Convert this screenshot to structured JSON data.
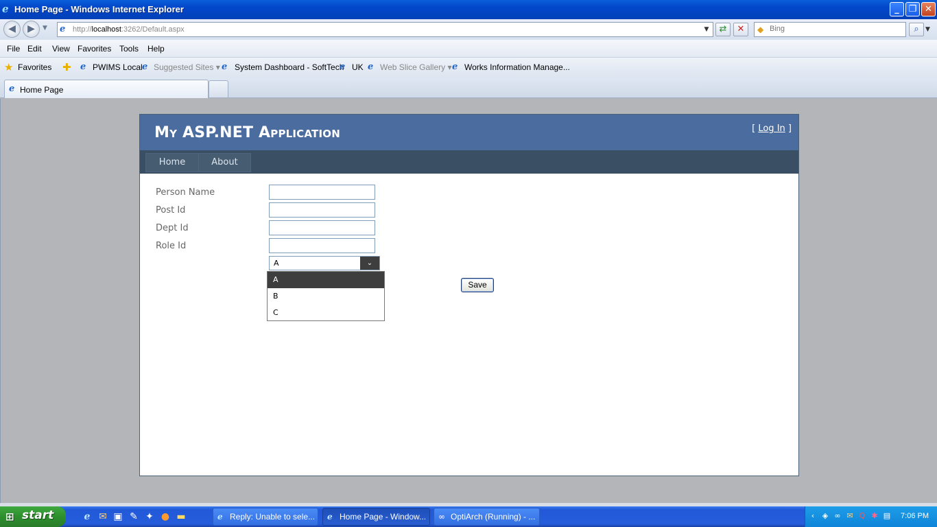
{
  "window": {
    "title": "Home Page - Windows Internet Explorer"
  },
  "addressbar": {
    "url_prefix": "http://",
    "url_host": "localhost",
    "url_suffix": ":3262/Default.aspx",
    "search_placeholder": "Bing"
  },
  "menu": [
    "File",
    "Edit",
    "View",
    "Favorites",
    "Tools",
    "Help"
  ],
  "favorites": {
    "label": "Favorites",
    "items": [
      {
        "label": "PWIMS Local"
      },
      {
        "label": "Suggested Sites ▾"
      },
      {
        "label": "System Dashboard - SoftTech"
      },
      {
        "label": "UK"
      },
      {
        "label": "Web Slice Gallery ▾"
      },
      {
        "label": "Works Information Manage..."
      }
    ]
  },
  "tabs": [
    {
      "label": "Home Page"
    }
  ],
  "page": {
    "title": "My ASP.NET Application",
    "login_open": "[ ",
    "login_link": "Log In",
    "login_close": " ]",
    "nav": [
      "Home",
      "About"
    ],
    "form": {
      "fields": [
        {
          "label": "Person Name",
          "value": ""
        },
        {
          "label": "Post Id",
          "value": ""
        },
        {
          "label": "Dept Id",
          "value": ""
        },
        {
          "label": "Role Id",
          "value": ""
        }
      ],
      "select": {
        "selected": "A",
        "options": [
          "A",
          "B",
          "C"
        ]
      },
      "save_label": "Save"
    }
  },
  "taskbar": {
    "start_label": "start",
    "items": [
      {
        "label": "Reply: Unable to sele..."
      },
      {
        "label": "Home Page - Window..."
      },
      {
        "label": "OptiArch (Running) - ..."
      }
    ],
    "clock": "7:06 PM"
  }
}
